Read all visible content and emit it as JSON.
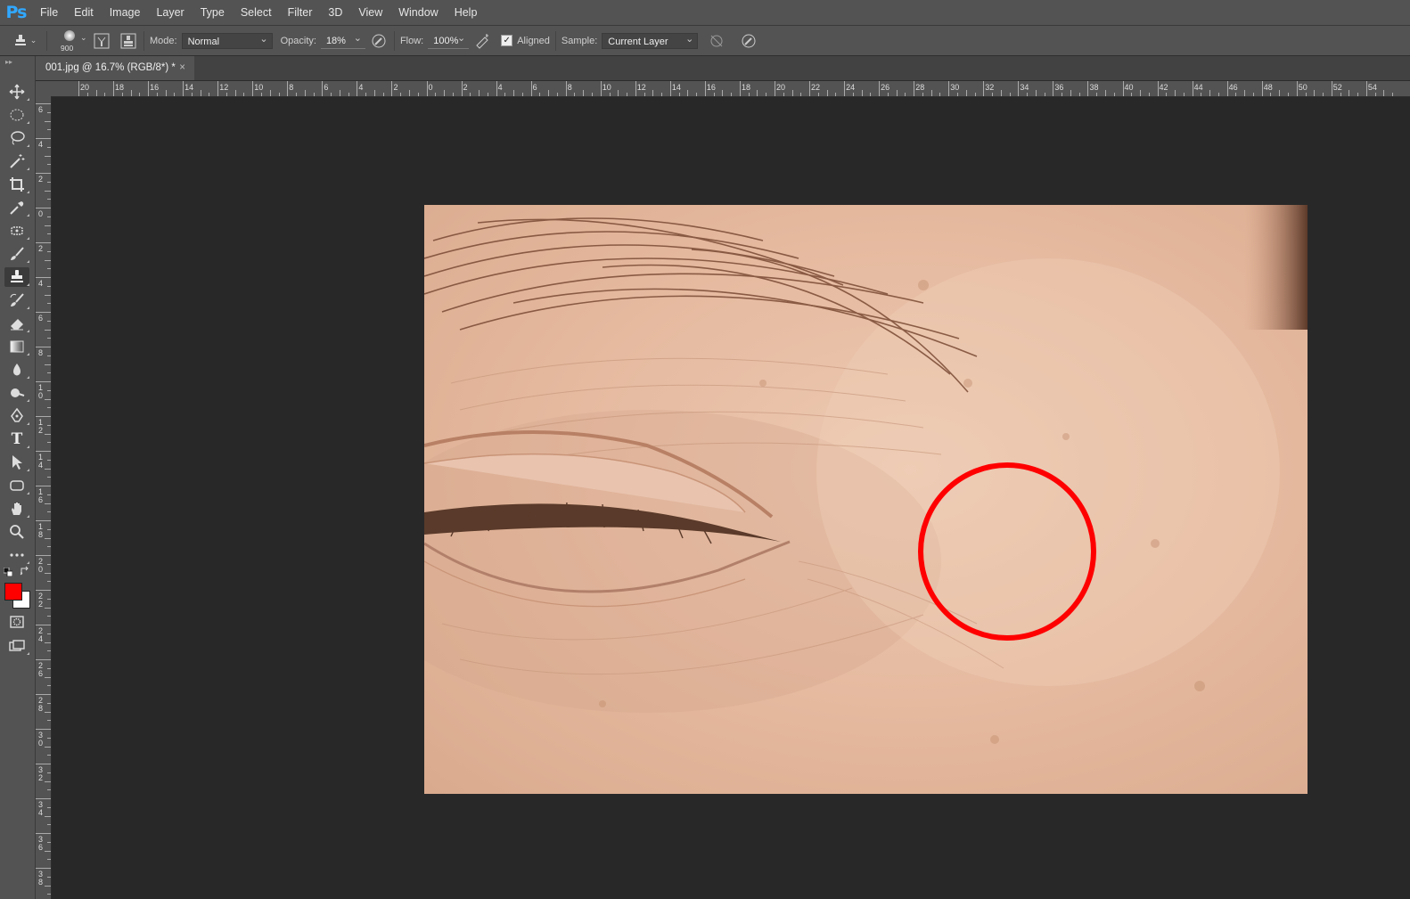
{
  "app": {
    "logo": "Ps"
  },
  "menu": [
    "File",
    "Edit",
    "Image",
    "Layer",
    "Type",
    "Select",
    "Filter",
    "3D",
    "View",
    "Window",
    "Help"
  ],
  "options": {
    "brush_size": "900",
    "mode_label": "Mode:",
    "mode_value": "Normal",
    "opacity_label": "Opacity:",
    "opacity_value": "18%",
    "flow_label": "Flow:",
    "flow_value": "100%",
    "aligned_label": "Aligned",
    "aligned_checked": true,
    "sample_label": "Sample:",
    "sample_value": "Current Layer"
  },
  "document_tab": {
    "title": "001.jpg @ 16.7% (RGB/8*) *",
    "close_glyph": "×"
  },
  "ruler": {
    "horizontal": [
      "20",
      "18",
      "16",
      "14",
      "12",
      "10",
      "8",
      "6",
      "4",
      "2",
      "0",
      "2",
      "4",
      "6",
      "8",
      "10",
      "12",
      "14",
      "16",
      "18",
      "20",
      "22",
      "24",
      "26",
      "28",
      "30",
      "32",
      "34",
      "36",
      "38",
      "40",
      "42",
      "44",
      "46",
      "48",
      "50",
      "52",
      "54"
    ],
    "vertical": [
      "6",
      "4",
      "2",
      "0",
      "2",
      "4",
      "6",
      "8",
      "10",
      "12",
      "14",
      "16",
      "18",
      "20",
      "22",
      "24",
      "26",
      "28",
      "30",
      "32",
      "34",
      "36",
      "38"
    ]
  },
  "tools": [
    {
      "name": "move-tool-icon",
      "active": false
    },
    {
      "name": "elliptical-marquee-tool-icon",
      "active": false
    },
    {
      "name": "lasso-tool-icon",
      "active": false
    },
    {
      "name": "magic-wand-tool-icon",
      "active": false
    },
    {
      "name": "crop-tool-icon",
      "active": false
    },
    {
      "name": "eyedropper-tool-icon",
      "active": false
    },
    {
      "name": "spot-healing-tool-icon",
      "active": false
    },
    {
      "name": "brush-tool-icon",
      "active": false
    },
    {
      "name": "clone-stamp-tool-icon",
      "active": true
    },
    {
      "name": "history-brush-tool-icon",
      "active": false
    },
    {
      "name": "eraser-tool-icon",
      "active": false
    },
    {
      "name": "gradient-tool-icon",
      "active": false
    },
    {
      "name": "blur-tool-icon",
      "active": false
    },
    {
      "name": "dodge-tool-icon",
      "active": false
    },
    {
      "name": "pen-tool-icon",
      "active": false
    },
    {
      "name": "type-tool-icon",
      "active": false
    },
    {
      "name": "path-selection-tool-icon",
      "active": false
    },
    {
      "name": "rectangle-tool-icon",
      "active": false
    },
    {
      "name": "hand-tool-icon",
      "active": false
    },
    {
      "name": "zoom-tool-icon",
      "active": false
    },
    {
      "name": "more-tools-icon",
      "active": false
    }
  ],
  "colors": {
    "foreground": "#ff0000",
    "background": "#ffffff",
    "annotation_circle": "#ff0000",
    "type_tool_glyph": "T"
  }
}
